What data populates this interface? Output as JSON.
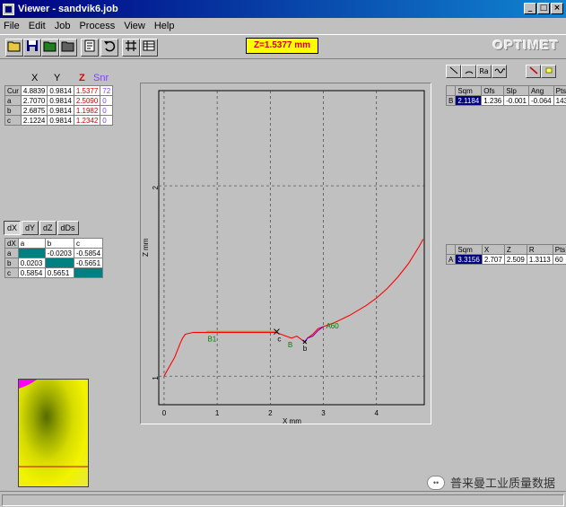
{
  "window": {
    "title": "Viewer - sandvik6.job"
  },
  "menu": {
    "file": "File",
    "edit": "Edit",
    "job": "Job",
    "process": "Process",
    "view": "View",
    "help": "Help"
  },
  "toolbar": {
    "z_readout": "Z=1.5377 mm",
    "brand": "OPTIMET"
  },
  "coords": {
    "headers": {
      "x": "X",
      "y": "Y",
      "z": "Z",
      "snr": "Snr"
    },
    "rows": [
      {
        "name": "Cur",
        "x": "4.8839",
        "y": "0.9814",
        "z": "1.5377",
        "snr": "72"
      },
      {
        "name": "a",
        "x": "2.7070",
        "y": "0.9814",
        "z": "2.5090",
        "snr": "0"
      },
      {
        "name": "b",
        "x": "2.6875",
        "y": "0.9814",
        "z": "1.1982",
        "snr": "0"
      },
      {
        "name": "c",
        "x": "2.1224",
        "y": "0.9814",
        "z": "1.2342",
        "snr": "0"
      }
    ]
  },
  "diff": {
    "tabs": [
      "dX",
      "dY",
      "dZ",
      "dDs"
    ],
    "corner": "dX",
    "cols": [
      "a",
      "b",
      "c"
    ],
    "rows": [
      {
        "name": "a",
        "a": "",
        "b": "-0.0203",
        "c": "-0.5854"
      },
      {
        "name": "b",
        "a": "0.0203",
        "b": "",
        "c": "-0.5651"
      },
      {
        "name": "c",
        "a": "0.5854",
        "b": "0.5651",
        "c": ""
      }
    ]
  },
  "segments": {
    "headers": [
      "",
      "Sqm",
      "Ofs",
      "Slp",
      "Ang",
      "Pts"
    ],
    "row": [
      "B",
      "2.1184",
      "1.236",
      "-0.001",
      "-0.064",
      "143"
    ]
  },
  "arcs": {
    "headers": [
      "",
      "Sqm",
      "X",
      "Z",
      "R",
      "Pts"
    ],
    "row": [
      "A",
      "3.3156",
      "2.707",
      "2.509",
      "1.3113",
      "60"
    ]
  },
  "mode_buttons": [
    "line-tool-icon",
    "arc-tool-icon",
    "Ra",
    "wave-tool-icon",
    "pencil-tool-icon",
    "eraser-tool-icon"
  ],
  "plot": {
    "xlabel": "X mm",
    "ylabel": "Z mm",
    "x_ticks": [
      "0",
      "1",
      "2",
      "3",
      "4"
    ],
    "y_ticks": [
      "1",
      "2"
    ],
    "labels": {
      "b1": "B1",
      "c": "c",
      "b": "B",
      "b_small": "b",
      "a60": "A60"
    }
  },
  "chart_data": {
    "type": "line",
    "title": "",
    "xlabel": "X mm",
    "ylabel": "Z mm",
    "xlim": [
      -0.1,
      4.9
    ],
    "ylim": [
      0.85,
      2.5
    ],
    "grid": true,
    "series": [
      {
        "color": "#ff0000",
        "x": [
          0.0,
          0.1,
          0.2,
          0.3,
          0.35,
          0.4,
          0.55,
          0.8,
          1.0,
          1.5,
          2.0,
          2.1,
          2.2,
          2.4,
          2.5,
          2.6,
          2.65,
          2.7,
          2.8,
          2.9,
          3.0,
          3.2,
          3.5,
          3.8,
          4.0,
          4.2,
          4.4,
          4.6,
          4.8,
          4.88
        ],
        "z": [
          1.0,
          1.05,
          1.1,
          1.17,
          1.2,
          1.22,
          1.23,
          1.23,
          1.23,
          1.23,
          1.23,
          1.23,
          1.22,
          1.2,
          1.21,
          1.19,
          1.18,
          1.2,
          1.22,
          1.25,
          1.26,
          1.28,
          1.32,
          1.37,
          1.41,
          1.46,
          1.52,
          1.59,
          1.68,
          1.72
        ]
      },
      {
        "color": "#a0a000",
        "x": [
          0.8,
          1.0,
          1.5,
          2.0,
          2.12
        ],
        "z": [
          1.235,
          1.235,
          1.235,
          1.235,
          1.234
        ]
      },
      {
        "color": "#8000c0",
        "x": [
          2.6,
          2.65,
          2.7,
          2.8,
          2.9,
          3.0
        ],
        "z": [
          1.19,
          1.18,
          1.2,
          1.21,
          1.24,
          1.26
        ]
      }
    ]
  }
}
